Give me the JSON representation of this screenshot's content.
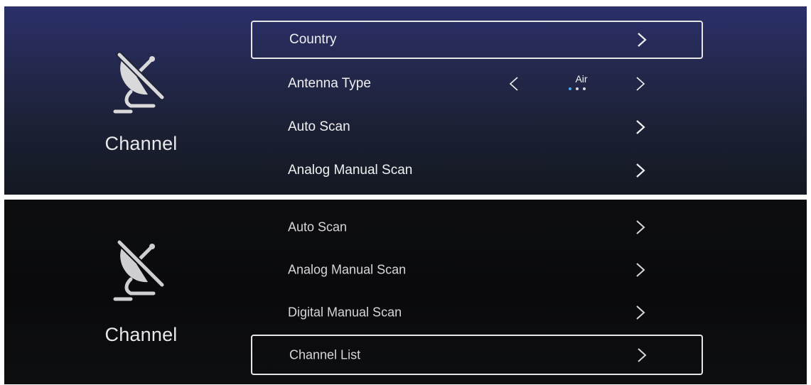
{
  "top_screen": {
    "section_title": "Channel",
    "icon": "satellite-dish-off-icon",
    "menu": [
      {
        "label": "Country",
        "focused": true
      },
      {
        "label": "Antenna Type",
        "value": "Air",
        "focused": false
      },
      {
        "label": "Auto Scan",
        "focused": false
      },
      {
        "label": "Analog Manual Scan",
        "focused": false
      }
    ]
  },
  "bottom_screen": {
    "section_title": "Channel",
    "icon": "satellite-dish-off-icon",
    "menu": [
      {
        "label": "Auto Scan",
        "focused": false
      },
      {
        "label": "Analog Manual Scan",
        "focused": false
      },
      {
        "label": "Digital Manual Scan",
        "focused": false
      },
      {
        "label": "Channel List",
        "focused": true
      }
    ]
  },
  "colors": {
    "accent_dot": "#3fa9f5",
    "text": "#f0f0f2",
    "focus_border": "#e6e6e6"
  }
}
